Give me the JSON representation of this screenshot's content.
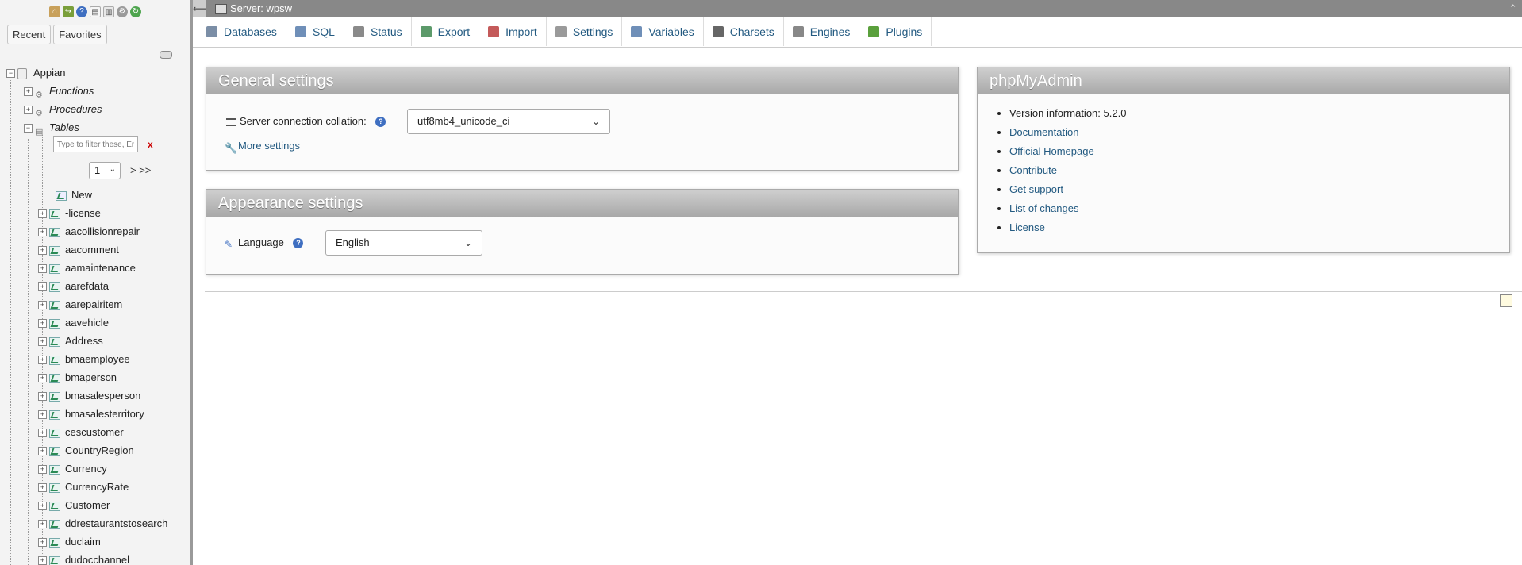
{
  "nav": {
    "recent_label": "Recent",
    "favorites_label": "Favorites",
    "db_name": "Appian",
    "groups": [
      "Functions",
      "Procedures",
      "Tables"
    ],
    "filter_placeholder": "Type to filter these, Enter to search all",
    "filter_clear": "x",
    "page_value": "1",
    "page_next": "> >>",
    "new_label": "New",
    "tables": [
      "-license",
      "aacollisionrepair",
      "aacomment",
      "aamaintenance",
      "aarefdata",
      "aarepairitem",
      "aavehicle",
      "Address",
      "bmaemployee",
      "bmaperson",
      "bmasalesperson",
      "bmasalesterritory",
      "cescustomer",
      "CountryRegion",
      "Currency",
      "CurrencyRate",
      "Customer",
      "ddrestaurantstosearch",
      "duclaim",
      "dudocchannel"
    ]
  },
  "topbar": {
    "title": "Server: wpsw"
  },
  "menu": {
    "items": [
      {
        "label": "Databases",
        "color": "#7b8ea6"
      },
      {
        "label": "SQL",
        "color": "#6f8fb8"
      },
      {
        "label": "Status",
        "color": "#8a8a8a"
      },
      {
        "label": "Export",
        "color": "#5c9a6a"
      },
      {
        "label": "Import",
        "color": "#c45a5a"
      },
      {
        "label": "Settings",
        "color": "#9a9a9a"
      },
      {
        "label": "Variables",
        "color": "#6f8fb8"
      },
      {
        "label": "Charsets",
        "color": "#666666"
      },
      {
        "label": "Engines",
        "color": "#888888"
      },
      {
        "label": "Plugins",
        "color": "#5aa03c"
      }
    ]
  },
  "general": {
    "title": "General settings",
    "collation_label": "Server connection collation:",
    "collation_value": "utf8mb4_unicode_ci",
    "more_settings": "More settings"
  },
  "appearance": {
    "title": "Appearance settings",
    "language_label": "Language",
    "language_value": "English"
  },
  "pma": {
    "title": "phpMyAdmin",
    "version_label": "Version information: 5.2.0",
    "links": [
      "Documentation",
      "Official Homepage",
      "Contribute",
      "Get support",
      "List of changes",
      "License"
    ]
  }
}
